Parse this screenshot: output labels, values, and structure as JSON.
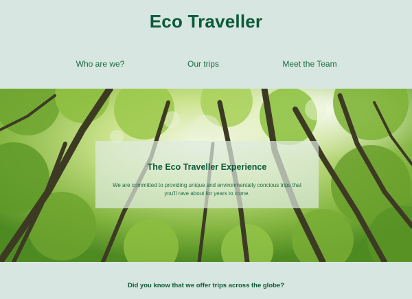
{
  "site": {
    "title": "Eco Traveller"
  },
  "nav": {
    "items": [
      {
        "label": "Who are we?"
      },
      {
        "label": "Our trips"
      },
      {
        "label": "Meet the Team"
      }
    ]
  },
  "hero": {
    "image_subject": "forest-canopy",
    "card": {
      "title": "The Eco Traveller Experience",
      "text": "We are committed to providing unique and environmentally concious trips that you'll rave about for years to come."
    }
  },
  "section": {
    "question": "Did you know that we offer trips across the globe?"
  },
  "colors": {
    "background": "#d7e6e0",
    "accent": "#0b5a38"
  }
}
